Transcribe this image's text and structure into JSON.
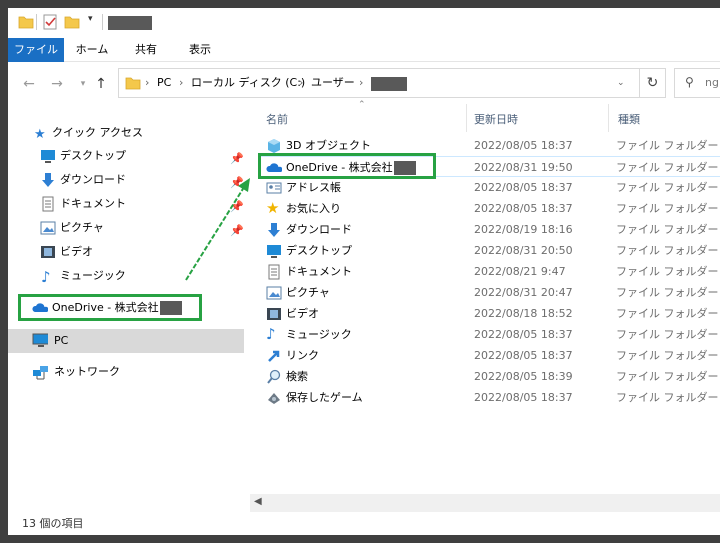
{
  "window": {
    "title_redacted": true
  },
  "ribbon": {
    "tabs": [
      {
        "label": "ファイル",
        "active": true
      },
      {
        "label": "ホーム"
      },
      {
        "label": "共有"
      },
      {
        "label": "表示"
      }
    ]
  },
  "address": {
    "crumbs": [
      "PC",
      "ローカル ディスク (C:)",
      "ユーザー"
    ],
    "search_placeholder": "ng"
  },
  "sidebar": {
    "quick_access": "クイック アクセス",
    "items": [
      {
        "label": "デスクトップ",
        "icon": "desktop-icon",
        "pinned": true
      },
      {
        "label": "ダウンロード",
        "icon": "download-icon",
        "pinned": true
      },
      {
        "label": "ドキュメント",
        "icon": "document-icon",
        "pinned": true
      },
      {
        "label": "ピクチャ",
        "icon": "pictures-icon",
        "pinned": true
      },
      {
        "label": "ビデオ",
        "icon": "video-icon"
      },
      {
        "label": "ミュージック",
        "icon": "music-icon"
      }
    ],
    "onedrive": "OneDrive - 株式会社",
    "pc": "PC",
    "network": "ネットワーク"
  },
  "list": {
    "headers": {
      "name": "名前",
      "date": "更新日時",
      "type": "種類"
    },
    "rows": [
      {
        "name": "3D オブジェクト",
        "date": "2022/08/05 18:37",
        "type": "ファイル フォルダー",
        "icon": "3d-objects-icon"
      },
      {
        "name": "OneDrive - 株式会社",
        "date": "2022/08/31 19:50",
        "type": "ファイル フォルダー",
        "icon": "onedrive-icon"
      },
      {
        "name": "アドレス帳",
        "date": "2022/08/05 18:37",
        "type": "ファイル フォルダー",
        "icon": "contacts-icon"
      },
      {
        "name": "お気に入り",
        "date": "2022/08/05 18:37",
        "type": "ファイル フォルダー",
        "icon": "favorites-icon"
      },
      {
        "name": "ダウンロード",
        "date": "2022/08/19 18:16",
        "type": "ファイル フォルダー",
        "icon": "download-icon"
      },
      {
        "name": "デスクトップ",
        "date": "2022/08/31 20:50",
        "type": "ファイル フォルダー",
        "icon": "desktop-icon"
      },
      {
        "name": "ドキュメント",
        "date": "2022/08/21 9:47",
        "type": "ファイル フォルダー",
        "icon": "document-icon"
      },
      {
        "name": "ピクチャ",
        "date": "2022/08/31 20:47",
        "type": "ファイル フォルダー",
        "icon": "pictures-icon"
      },
      {
        "name": "ビデオ",
        "date": "2022/08/18 18:52",
        "type": "ファイル フォルダー",
        "icon": "video-icon"
      },
      {
        "name": "ミュージック",
        "date": "2022/08/05 18:37",
        "type": "ファイル フォルダー",
        "icon": "music-icon"
      },
      {
        "name": "リンク",
        "date": "2022/08/05 18:37",
        "type": "ファイル フォルダー",
        "icon": "links-icon"
      },
      {
        "name": "検索",
        "date": "2022/08/05 18:39",
        "type": "ファイル フォルダー",
        "icon": "search-icon"
      },
      {
        "name": "保存したゲーム",
        "date": "2022/08/05 18:37",
        "type": "ファイル フォルダー",
        "icon": "saved-games-icon"
      }
    ]
  },
  "status": {
    "count": "13 個の項目"
  },
  "colors": {
    "accent": "#1a6fc4",
    "highlight": "#27a243",
    "selected_bg": "#d9d9d9"
  }
}
